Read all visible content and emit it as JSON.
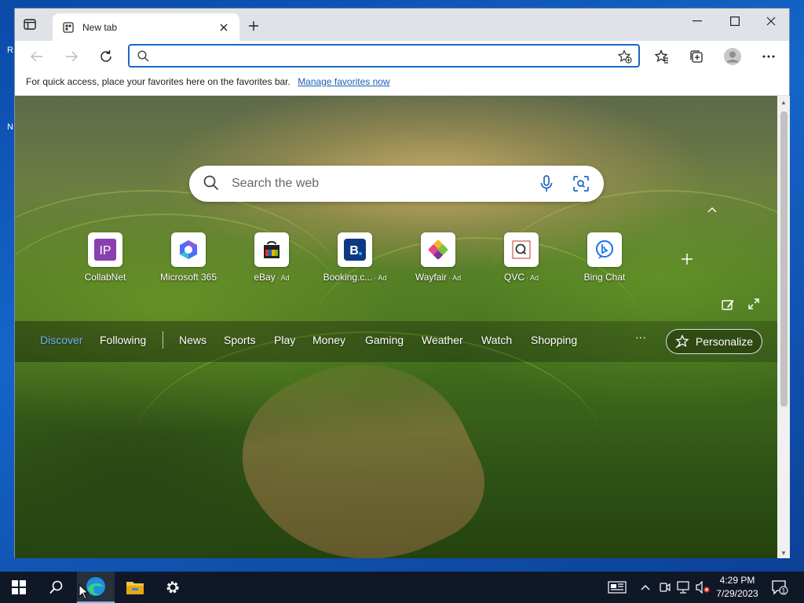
{
  "desktop": {
    "peek_1": "R",
    "peek_2": "N"
  },
  "browser": {
    "tab": {
      "title": "New tab"
    },
    "address": {
      "value": "",
      "placeholder": ""
    },
    "favorites_bar": {
      "message": "For quick access, place your favorites here on the favorites bar.",
      "link": "Manage favorites now"
    }
  },
  "newtab": {
    "search": {
      "placeholder": "Search the web"
    },
    "tiles": [
      {
        "label": "CollabNet",
        "ad": "",
        "icon": "collabnet-icon",
        "color": "#8a3fb0"
      },
      {
        "label": "Microsoft 365",
        "ad": "",
        "icon": "microsoft-365-icon",
        "color": "#4c6ef5"
      },
      {
        "label": "eBay",
        "ad": "· Ad",
        "icon": "ebay-icon",
        "color": "#222222"
      },
      {
        "label": "Booking.c...",
        "ad": "· Ad",
        "icon": "booking-icon",
        "color": "#0b3a85"
      },
      {
        "label": "Wayfair",
        "ad": "· Ad",
        "icon": "wayfair-icon",
        "color": "#7b2fa0"
      },
      {
        "label": "QVC",
        "ad": "· Ad",
        "icon": "qvc-icon",
        "color": "#c0392b"
      },
      {
        "label": "Bing Chat",
        "ad": "",
        "icon": "bing-chat-icon",
        "color": "#1a73e8"
      }
    ],
    "nav": {
      "discover": "Discover",
      "following": "Following",
      "items": [
        "News",
        "Sports",
        "Play",
        "Money",
        "Gaming",
        "Weather",
        "Watch",
        "Shopping"
      ],
      "more": "···",
      "personalize": "Personalize"
    }
  },
  "taskbar": {
    "clock_time": "4:29 PM",
    "clock_date": "7/29/2023",
    "notification_count": "1"
  },
  "colors": {
    "accent": "#1a68c8",
    "active_nav": "#6fb3f0",
    "taskbar": "#101828"
  }
}
